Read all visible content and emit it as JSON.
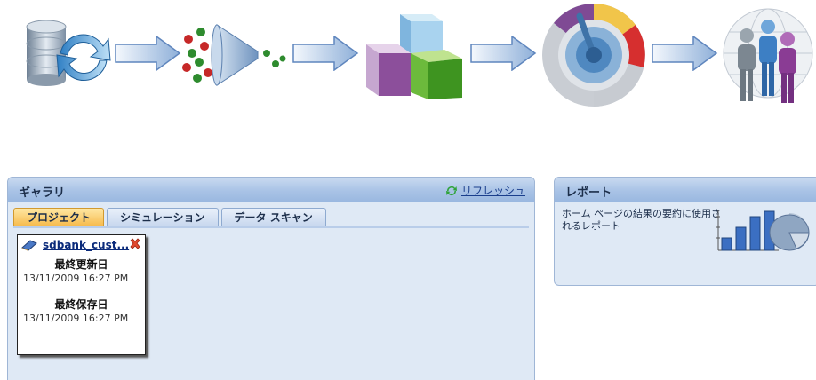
{
  "workflow": {
    "steps": [
      {
        "icon": "data-sync-icon"
      },
      {
        "icon": "filter-funnel-icon"
      },
      {
        "icon": "cubes-icon"
      },
      {
        "icon": "dial-gauge-icon"
      },
      {
        "icon": "people-globe-icon"
      }
    ]
  },
  "gallery": {
    "title": "ギャラリ",
    "refresh_label": "リフレッシュ",
    "tabs": [
      {
        "label": "プロジェクト",
        "active": true
      },
      {
        "label": "シミュレーション",
        "active": false
      },
      {
        "label": "データ スキャン",
        "active": false
      }
    ],
    "card": {
      "name": "sdbank_cust...",
      "modified_label": "最終更新日",
      "modified_value": "13/11/2009 16:27 PM",
      "saved_label": "最終保存日",
      "saved_value": "13/11/2009 16:27 PM"
    }
  },
  "reports": {
    "title": "レポート",
    "description": "ホーム ページの結果の要約に使用されるレポート"
  },
  "colors": {
    "panel_bg": "#dfe9f5",
    "header": "#a9c3e6",
    "active_tab": "#f6b94a"
  }
}
